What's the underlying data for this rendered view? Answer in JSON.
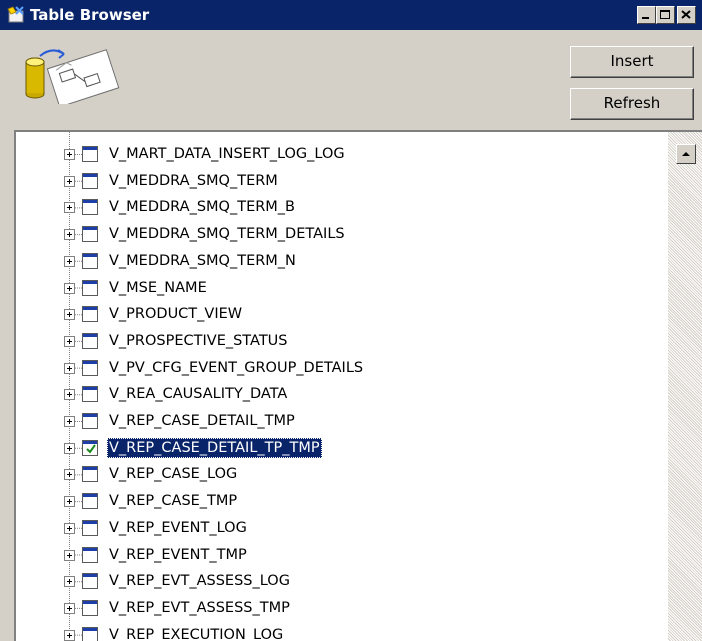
{
  "window": {
    "title": "Table Browser",
    "icon": "table-browser-icon"
  },
  "buttons": {
    "insert_label": "Insert",
    "refresh_label": "Refresh"
  },
  "tree": {
    "items": [
      {
        "label": "V_MART_DATA_INSERT_LOG_LOG",
        "selected": false,
        "checked": false
      },
      {
        "label": "V_MEDDRA_SMQ_TERM",
        "selected": false,
        "checked": false
      },
      {
        "label": "V_MEDDRA_SMQ_TERM_B",
        "selected": false,
        "checked": false
      },
      {
        "label": "V_MEDDRA_SMQ_TERM_DETAILS",
        "selected": false,
        "checked": false
      },
      {
        "label": "V_MEDDRA_SMQ_TERM_N",
        "selected": false,
        "checked": false
      },
      {
        "label": "V_MSE_NAME",
        "selected": false,
        "checked": false
      },
      {
        "label": "V_PRODUCT_VIEW",
        "selected": false,
        "checked": false
      },
      {
        "label": "V_PROSPECTIVE_STATUS",
        "selected": false,
        "checked": false
      },
      {
        "label": "V_PV_CFG_EVENT_GROUP_DETAILS",
        "selected": false,
        "checked": false
      },
      {
        "label": "V_REA_CAUSALITY_DATA",
        "selected": false,
        "checked": false
      },
      {
        "label": "V_REP_CASE_DETAIL_TMP",
        "selected": false,
        "checked": false
      },
      {
        "label": "V_REP_CASE_DETAIL_TP_TMP",
        "selected": true,
        "checked": true
      },
      {
        "label": "V_REP_CASE_LOG",
        "selected": false,
        "checked": false
      },
      {
        "label": "V_REP_CASE_TMP",
        "selected": false,
        "checked": false
      },
      {
        "label": "V_REP_EVENT_LOG",
        "selected": false,
        "checked": false
      },
      {
        "label": "V_REP_EVENT_TMP",
        "selected": false,
        "checked": false
      },
      {
        "label": "V_REP_EVT_ASSESS_LOG",
        "selected": false,
        "checked": false
      },
      {
        "label": "V_REP_EVT_ASSESS_TMP",
        "selected": false,
        "checked": false
      },
      {
        "label": "V_REP_EXECUTION_LOG",
        "selected": false,
        "checked": false
      }
    ]
  },
  "colors": {
    "title_bar": "#0a246a",
    "face": "#d4d0c8",
    "selection": "#0a246a",
    "check": "#1c8a1c"
  }
}
